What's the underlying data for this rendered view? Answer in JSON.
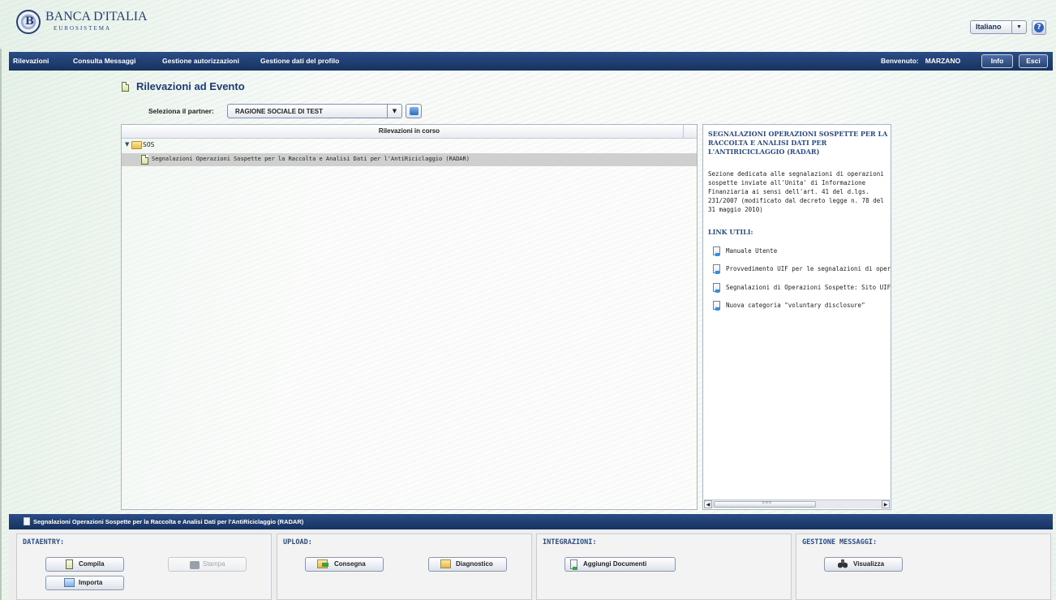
{
  "brand": {
    "name": "BANCA D'ITALIA",
    "subtitle": "EUROSISTEMA"
  },
  "header": {
    "language": "Italiano",
    "help_icon": "help-icon"
  },
  "nav": {
    "items": [
      "Rilevazioni",
      "Consulta Messaggi",
      "Gestione autorizzazioni",
      "Gestione dati del profilo"
    ],
    "welcome_label": "Benvenuto:",
    "username": "MARZANO",
    "info_button": "Info",
    "exit_button": "Esci"
  },
  "page": {
    "title": "Rilevazioni ad Evento",
    "partner_label": "Seleziona il partner:",
    "partner_value": "RAGIONE SOCIALE DI TEST"
  },
  "tree": {
    "header": "Rilevazioni in corso",
    "folder": "SOS",
    "item": "Segnalazioni Operazioni Sospette per la Raccolta e Analisi Dati per l'AntiRiciclaggio (RADAR)"
  },
  "info": {
    "title": "SEGNALAZIONI OPERAZIONI SOSPETTE PER LA RACCOLTA E ANALISI DATI PER L'ANTIRICICLAGGIO (RADAR)",
    "description": "Sezione dedicata alle segnalazioni di operazioni sospette inviate all'Unita' di Informazione Finanziaria ai sensi dell'art. 41 del d.lgs. 231/2007 (modificato dal decreto legge n. 78 del 31 maggio 2010)",
    "links_title": "LINK UTILI:",
    "links": [
      "Manuale Utente",
      "Provvedimento UIF per le segnalazioni di operazioni sospette",
      "Segnalazioni di Operazioni Sospette: Sito UIF",
      "Nuova categoria \"voluntary disclosure\""
    ],
    "scroll_grip": "≡≡≡"
  },
  "bottom": {
    "title": "Segnalazioni Operazioni Sospette per la Raccolta e Analisi Dati per l'AntiRiciclaggio (RADAR)",
    "dataentry": {
      "title": "DATAENTRY:",
      "compila": "Compila",
      "stampa": "Stampa",
      "importa": "Importa"
    },
    "upload": {
      "title": "UPLOAD:",
      "consegna": "Consegna",
      "diagnostico": "Diagnostico"
    },
    "integrazioni": {
      "title": "INTEGRAZIONI:",
      "aggiungi": "Aggiungi Documenti"
    },
    "messaggi": {
      "title": "GESTIONE MESSAGGI:",
      "visualizza": "Visualizza"
    }
  },
  "colors": {
    "navbar": "#1f3d70",
    "accent_text": "#2a4c84",
    "selected_row": "#cfcfcf"
  }
}
